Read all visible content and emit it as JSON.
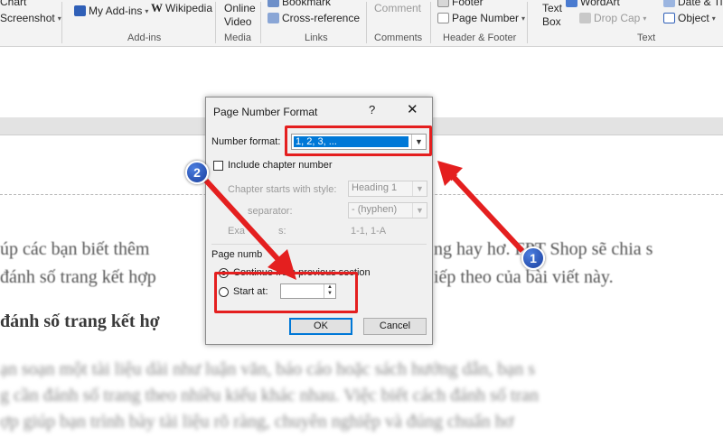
{
  "ribbon": {
    "chart_label": "Chart",
    "screenshot_label": "Screenshot",
    "my_addins_label": "My Add-ins",
    "wikipedia_label": "Wikipedia",
    "online_video_line1": "Online",
    "online_video_line2": "Video",
    "bookmark_label": "Bookmark",
    "cross_reference_label": "Cross-reference",
    "comment_label": "Comment",
    "footer_label": "Footer",
    "page_number_label": "Page Number",
    "text_box_line1": "Text",
    "text_box_line2": "Box",
    "wordart_label": "WordArt",
    "drop_cap_label": "Drop Cap",
    "date_time_label": "Date & Ti",
    "object_label": "Object",
    "groups": {
      "addins": "Add-ins",
      "media": "Media",
      "links": "Links",
      "comments": "Comments",
      "header_footer": "Header & Footer",
      "text": "Text"
    }
  },
  "document": {
    "line1": "úp các bạn biết thêm",
    "line1_right": "ng hay hơ. FPT Shop sẽ chia s",
    "line2": "đánh số trang kết hợp",
    "line2_right": "iếp theo của bài viết này.",
    "heading": "đánh số trang kết hợ",
    "blur1": "ạn soạn một tài liệu dài như luận văn, báo cáo hoặc sách hướng dẫn, bạn s",
    "blur2": "g cần đánh số trang theo nhiều kiểu khác nhau. Việc biết cách đánh số tran",
    "blur3": "ợp giúp bạn trình bày tài liệu rõ ràng, chuyên nghiệp và đúng chuẩn hơ"
  },
  "dialog": {
    "title": "Page Number Format",
    "help": "?",
    "close": "✕",
    "number_format_label": "Number format:",
    "number_format_value": "1, 2, 3, ...",
    "include_chapter_label": "Include chapter number",
    "chapter_style_label": "Chapter starts with style:",
    "chapter_style_value": "Heading 1",
    "separator_label": "Use separator:",
    "separator_visible": "separator:",
    "separator_value": "-   (hyphen)",
    "examples_label": "Examples:",
    "examples_visible": "Exa",
    "examples_tail": "s:",
    "examples_value": "1-1, 1-A",
    "page_numbering_label": "Page numbering",
    "page_numbering_visible": "Page numb",
    "continue_label": "Continue from previous section",
    "continue_visible": "Continue from previous section",
    "start_at_label": "Start at:",
    "start_at_value": "",
    "ok_label": "OK",
    "cancel_label": "Cancel"
  },
  "annotations": {
    "badge1": "1",
    "badge2": "2",
    "red_color": "#e41f1f",
    "badge_color": "#1b3f9e"
  }
}
